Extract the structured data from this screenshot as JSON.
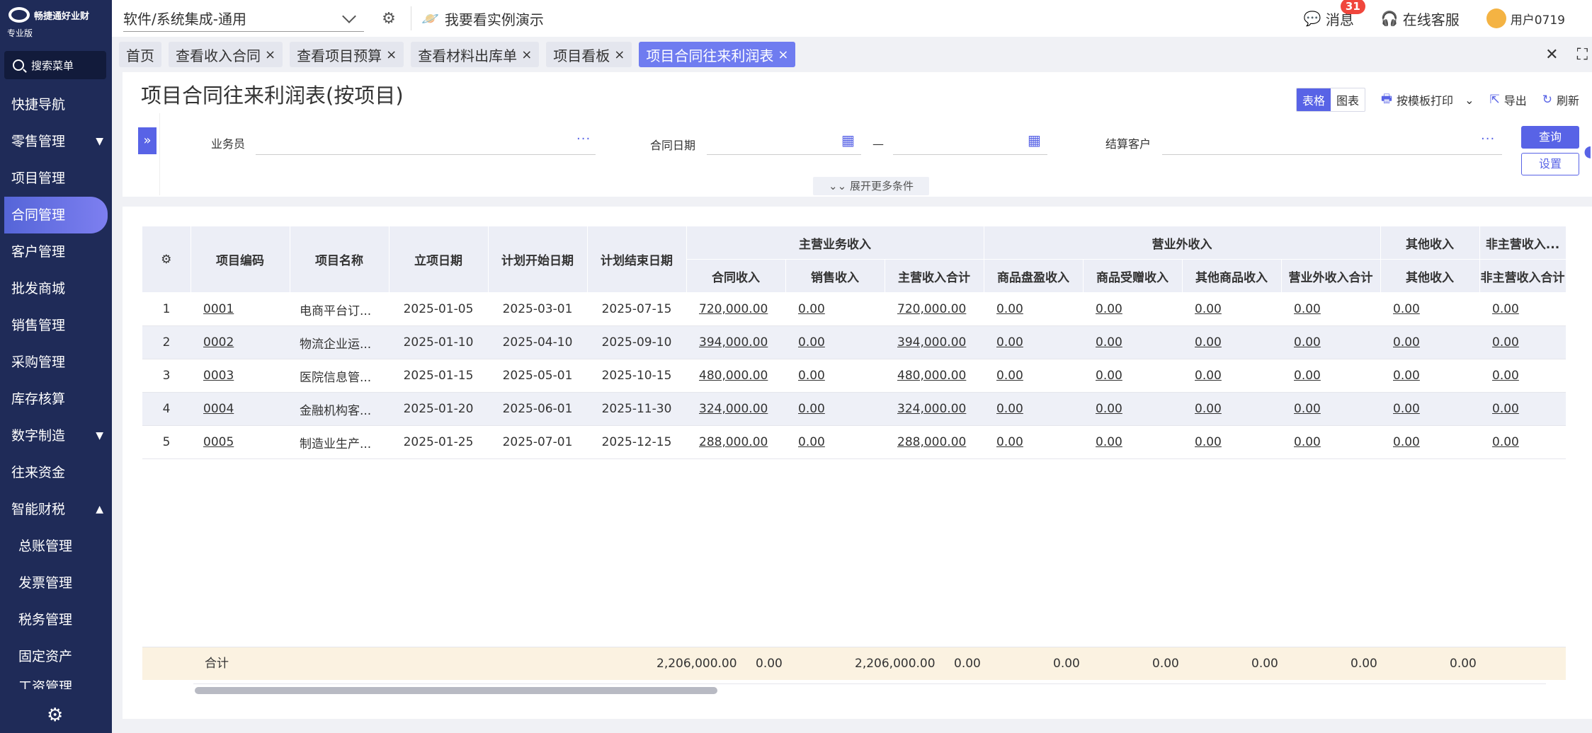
{
  "app": {
    "brand": "畅捷通好业财",
    "edition": "专业版"
  },
  "sidebar": {
    "search_label": "搜索菜单",
    "items": [
      {
        "label": "快捷导航"
      },
      {
        "label": "零售管理"
      },
      {
        "label": "项目管理"
      },
      {
        "label": "合同管理"
      },
      {
        "label": "客户管理"
      },
      {
        "label": "批发商城"
      },
      {
        "label": "销售管理"
      },
      {
        "label": "采购管理"
      },
      {
        "label": "库存核算"
      },
      {
        "label": "数字制造"
      },
      {
        "label": "往来资金"
      },
      {
        "label": "智能财税"
      },
      {
        "label": "总账管理"
      },
      {
        "label": "发票管理"
      },
      {
        "label": "税务管理"
      },
      {
        "label": "固定资产"
      },
      {
        "label": "工资管理"
      }
    ]
  },
  "topbar": {
    "industry": "软件/系统集成-通用",
    "demo_label": "我要看实例演示",
    "messages_label": "消息",
    "messages_count": "31",
    "service_label": "在线客服",
    "user_label": "用户0719"
  },
  "tabs": [
    {
      "label": "首页"
    },
    {
      "label": "查看收入合同"
    },
    {
      "label": "查看项目预算"
    },
    {
      "label": "查看材料出库单"
    },
    {
      "label": "项目看板"
    },
    {
      "label": "项目合同往来利润表"
    }
  ],
  "page": {
    "title": "项目合同往来利润表(按项目)",
    "view_table": "表格",
    "view_chart": "图表",
    "print_label": "按模板打印",
    "export_label": "导出",
    "refresh_label": "刷新"
  },
  "filters": {
    "salesperson_label": "业务员",
    "contract_date_label": "合同日期",
    "date_sep": "—",
    "customer_label": "结算客户",
    "query_button": "查询",
    "settings_button": "设置",
    "more_label": "展开更多条件"
  },
  "table": {
    "headers": {
      "code": "项目编码",
      "name": "项目名称",
      "start": "立项日期",
      "plan_start": "计划开始日期",
      "plan_end": "计划结束日期",
      "group_main": "主营业务收入",
      "group_nonop": "营业外收入",
      "group_other": "其他收入",
      "group_nonmain": "非主营收入...",
      "contract_income": "合同收入",
      "sales_income": "销售收入",
      "main_total": "主营收入合计",
      "inv_surplus": "商品盘盈收入",
      "gift_income": "商品受赠收入",
      "other_goods": "其他商品收入",
      "nonop_total": "营业外收入合计",
      "other_income": "其他收入",
      "nonmain_total": "非主营收入合计"
    },
    "rows": [
      {
        "no": "1",
        "code": "0001",
        "name": "电商平台订...",
        "start": "2025-01-05",
        "plan_start": "2025-03-01",
        "plan_end": "2025-07-15",
        "contract_income": "720,000.00",
        "sales_income": "0.00",
        "main_total": "720,000.00",
        "inv_surplus": "0.00",
        "gift_income": "0.00",
        "other_goods": "0.00",
        "nonop_total": "0.00",
        "other_income": "0.00",
        "nonmain_total": "0.00"
      },
      {
        "no": "2",
        "code": "0002",
        "name": "物流企业运...",
        "start": "2025-01-10",
        "plan_start": "2025-04-10",
        "plan_end": "2025-09-10",
        "contract_income": "394,000.00",
        "sales_income": "0.00",
        "main_total": "394,000.00",
        "inv_surplus": "0.00",
        "gift_income": "0.00",
        "other_goods": "0.00",
        "nonop_total": "0.00",
        "other_income": "0.00",
        "nonmain_total": "0.00"
      },
      {
        "no": "3",
        "code": "0003",
        "name": "医院信息管...",
        "start": "2025-01-15",
        "plan_start": "2025-05-01",
        "plan_end": "2025-10-15",
        "contract_income": "480,000.00",
        "sales_income": "0.00",
        "main_total": "480,000.00",
        "inv_surplus": "0.00",
        "gift_income": "0.00",
        "other_goods": "0.00",
        "nonop_total": "0.00",
        "other_income": "0.00",
        "nonmain_total": "0.00"
      },
      {
        "no": "4",
        "code": "0004",
        "name": "金融机构客...",
        "start": "2025-01-20",
        "plan_start": "2025-06-01",
        "plan_end": "2025-11-30",
        "contract_income": "324,000.00",
        "sales_income": "0.00",
        "main_total": "324,000.00",
        "inv_surplus": "0.00",
        "gift_income": "0.00",
        "other_goods": "0.00",
        "nonop_total": "0.00",
        "other_income": "0.00",
        "nonmain_total": "0.00"
      },
      {
        "no": "5",
        "code": "0005",
        "name": "制造业生产...",
        "start": "2025-01-25",
        "plan_start": "2025-07-01",
        "plan_end": "2025-12-15",
        "contract_income": "288,000.00",
        "sales_income": "0.00",
        "main_total": "288,000.00",
        "inv_surplus": "0.00",
        "gift_income": "0.00",
        "other_goods": "0.00",
        "nonop_total": "0.00",
        "other_income": "0.00",
        "nonmain_total": "0.00"
      }
    ],
    "total": {
      "label": "合计",
      "contract_income": "2,206,000.00",
      "sales_income": "0.00",
      "main_total": "2,206,000.00",
      "inv_surplus": "0.00",
      "gift_income": "0.00",
      "other_goods": "0.00",
      "nonop_total": "0.00",
      "other_income": "0.00",
      "nonmain_total": "0.00"
    }
  },
  "colors": {
    "sidebar_bg": "#1f2b58",
    "accent": "#5863e6",
    "active_tab": "#6f7cf0",
    "total_bg": "#fbf2e1",
    "badge": "#f0463c"
  }
}
